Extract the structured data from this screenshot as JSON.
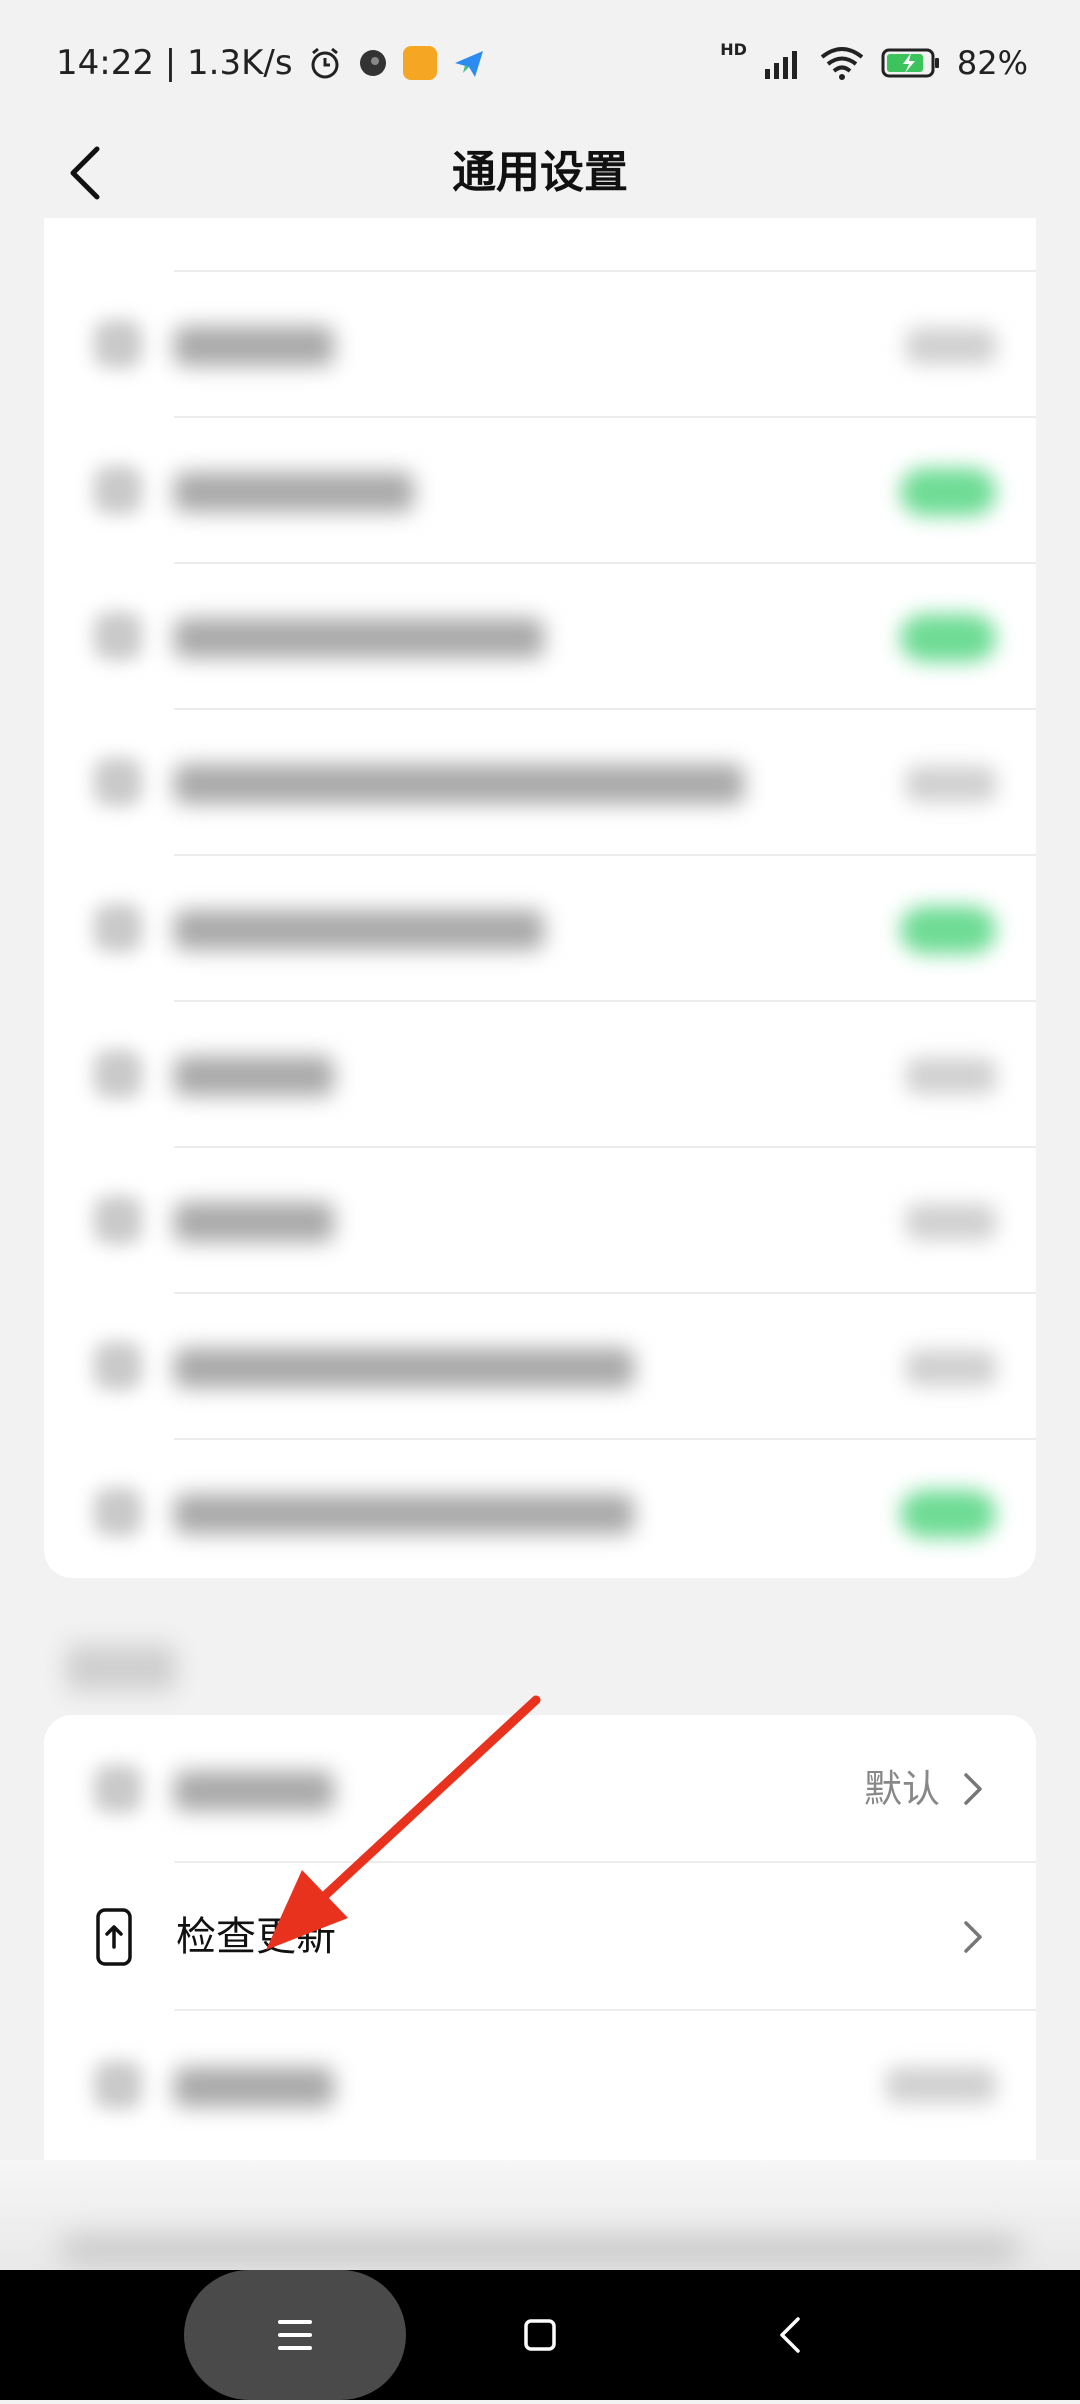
{
  "status_bar": {
    "time_speed": "14:22 | 1.3K/s",
    "network_label": "HD",
    "battery": "82%"
  },
  "header": {
    "title": "通用设置"
  },
  "settings": {
    "default_value": "默认",
    "check_update_label": "检查更新"
  },
  "colors": {
    "toggle_on": "#6edc95",
    "annotation_arrow": "#e8321e",
    "nav_bar": "#000000"
  },
  "icons": {
    "back": "chevron-left-icon",
    "chevron": "chevron-right-icon",
    "update": "phone-upload-icon",
    "nav_menu": "menu-icon",
    "nav_home": "square-icon",
    "nav_back": "back-triangle-icon"
  }
}
